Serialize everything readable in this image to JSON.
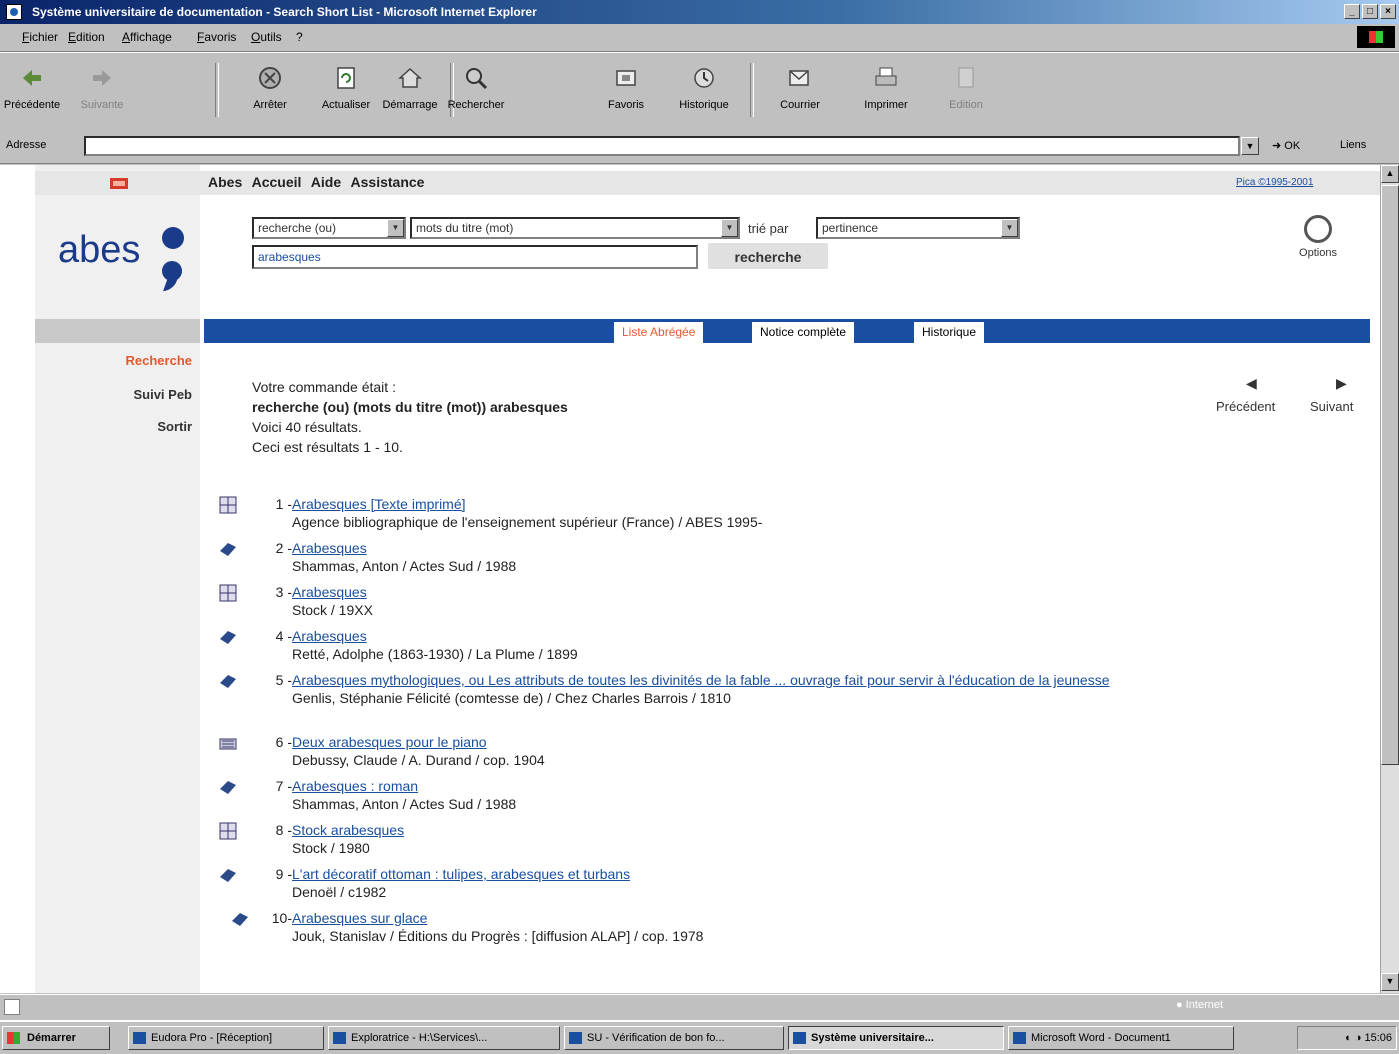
{
  "window": {
    "title": "Système universitaire de documentation - Search Short List - Microsoft Internet Explorer"
  },
  "menu": [
    "Fichier",
    "Edition",
    "Affichage",
    "Favoris",
    "Outils",
    "?"
  ],
  "toolbar": [
    {
      "label": "Précédente",
      "icon": "back-arrow-icon",
      "disabled": false
    },
    {
      "label": "Suivante",
      "icon": "forward-arrow-icon",
      "disabled": true
    },
    {
      "label": "Arrêter",
      "icon": "stop-icon",
      "disabled": false
    },
    {
      "label": "Actualiser",
      "icon": "refresh-icon",
      "disabled": false
    },
    {
      "label": "Démarrage",
      "icon": "home-icon",
      "disabled": false
    },
    {
      "label": "Rechercher",
      "icon": "search-icon",
      "disabled": false
    },
    {
      "label": "Favoris",
      "icon": "favorites-icon",
      "disabled": false
    },
    {
      "label": "Historique",
      "icon": "history-icon",
      "disabled": false
    },
    {
      "label": "Courrier",
      "icon": "mail-icon",
      "disabled": false
    },
    {
      "label": "Imprimer",
      "icon": "print-icon",
      "disabled": false
    },
    {
      "label": "Edition",
      "icon": "edit-icon",
      "disabled": true
    }
  ],
  "address": {
    "label": "Adresse",
    "value": "",
    "go": "OK",
    "links": "Liens"
  },
  "page": {
    "topnav": [
      "Abes",
      "Accueil",
      "Aide",
      "Assistance"
    ],
    "copyright": "Pica ©1995-2001",
    "logo_text": "abes",
    "search": {
      "mode": "recherche (ou)",
      "field": "mots du titre (mot)",
      "sort_label": "trié par",
      "sort": "pertinence",
      "query": "arabesques",
      "button": "recherche"
    },
    "options_label": "Options",
    "tabs": [
      "Liste Abrégée",
      "Notice complète",
      "Historique"
    ],
    "sidenav": [
      "Recherche",
      "Suivi Peb",
      "Sortir"
    ],
    "nav": {
      "prev": "Précédent",
      "next": "Suivant"
    },
    "message": {
      "line1": "Votre commande était :",
      "command": "recherche (ou) (mots du titre (mot)) arabesques",
      "count": "Voici 40 résultats.",
      "range": "Ceci est résultats 1 - 10."
    },
    "results": [
      {
        "num": "1 -",
        "title": "Arabesques [Texte imprimé]",
        "detail": "Agence bibliographique de l'enseignement supérieur (France) / ABES 1995-",
        "icon": "serial-icon"
      },
      {
        "num": "2 -",
        "title": "Arabesques",
        "detail": "Shammas, Anton / Actes Sud / 1988",
        "icon": "book-icon"
      },
      {
        "num": "3 -",
        "title": "Arabesques",
        "detail": "Stock / 19XX",
        "icon": "serial-icon"
      },
      {
        "num": "4 -",
        "title": "Arabesques",
        "detail": "Retté, Adolphe (1863-1930) / La Plume / 1899",
        "icon": "book-icon"
      },
      {
        "num": "5 -",
        "title": "Arabesques mythologiques, ou Les attributs de toutes les divinités de la fable ... ouvrage fait pour servir à l'éducation de la jeunesse",
        "detail": "Genlis, Stéphanie Félicité (comtesse de) / Chez Charles Barrois / 1810",
        "icon": "book-icon"
      },
      {
        "num": "6 -",
        "title": "Deux arabesques pour le piano",
        "detail": "Debussy, Claude / A. Durand / cop. 1904",
        "icon": "score-icon"
      },
      {
        "num": "7 -",
        "title": "Arabesques : roman",
        "detail": "Shammas, Anton / Actes Sud / 1988",
        "icon": "book-icon"
      },
      {
        "num": "8 -",
        "title": "Stock arabesques",
        "detail": "Stock / 1980",
        "icon": "serial-icon"
      },
      {
        "num": "9 -",
        "title": "L'art décoratif ottoman : tulipes, arabesques et turbans",
        "detail": "Denoël / c1982",
        "icon": "book-icon"
      },
      {
        "num": "10-",
        "title": "Arabesques sur glace",
        "detail": "Jouk, Stanislav / Éditions du Progrès : [diffusion ALAP] / cop. 1978",
        "icon": "book-icon"
      }
    ]
  },
  "status": {
    "zone": "Internet"
  },
  "taskbar": {
    "start": "Démarrer",
    "items": [
      {
        "label": "Eudora Pro - [Réception]",
        "active": false
      },
      {
        "label": "Exploratrice - H:\\Services\\...",
        "active": false
      },
      {
        "label": "SU - Vérification de bon fo...",
        "active": false
      },
      {
        "label": "Système universitaire...",
        "active": true
      },
      {
        "label": "Microsoft Word - Document1",
        "active": false
      }
    ],
    "clock": "15:06"
  },
  "colors": {
    "tabbar": "#1a4ea0",
    "accent_red": "#e3592b",
    "link": "#1a4fa0",
    "logo": "#1a3a8a"
  }
}
